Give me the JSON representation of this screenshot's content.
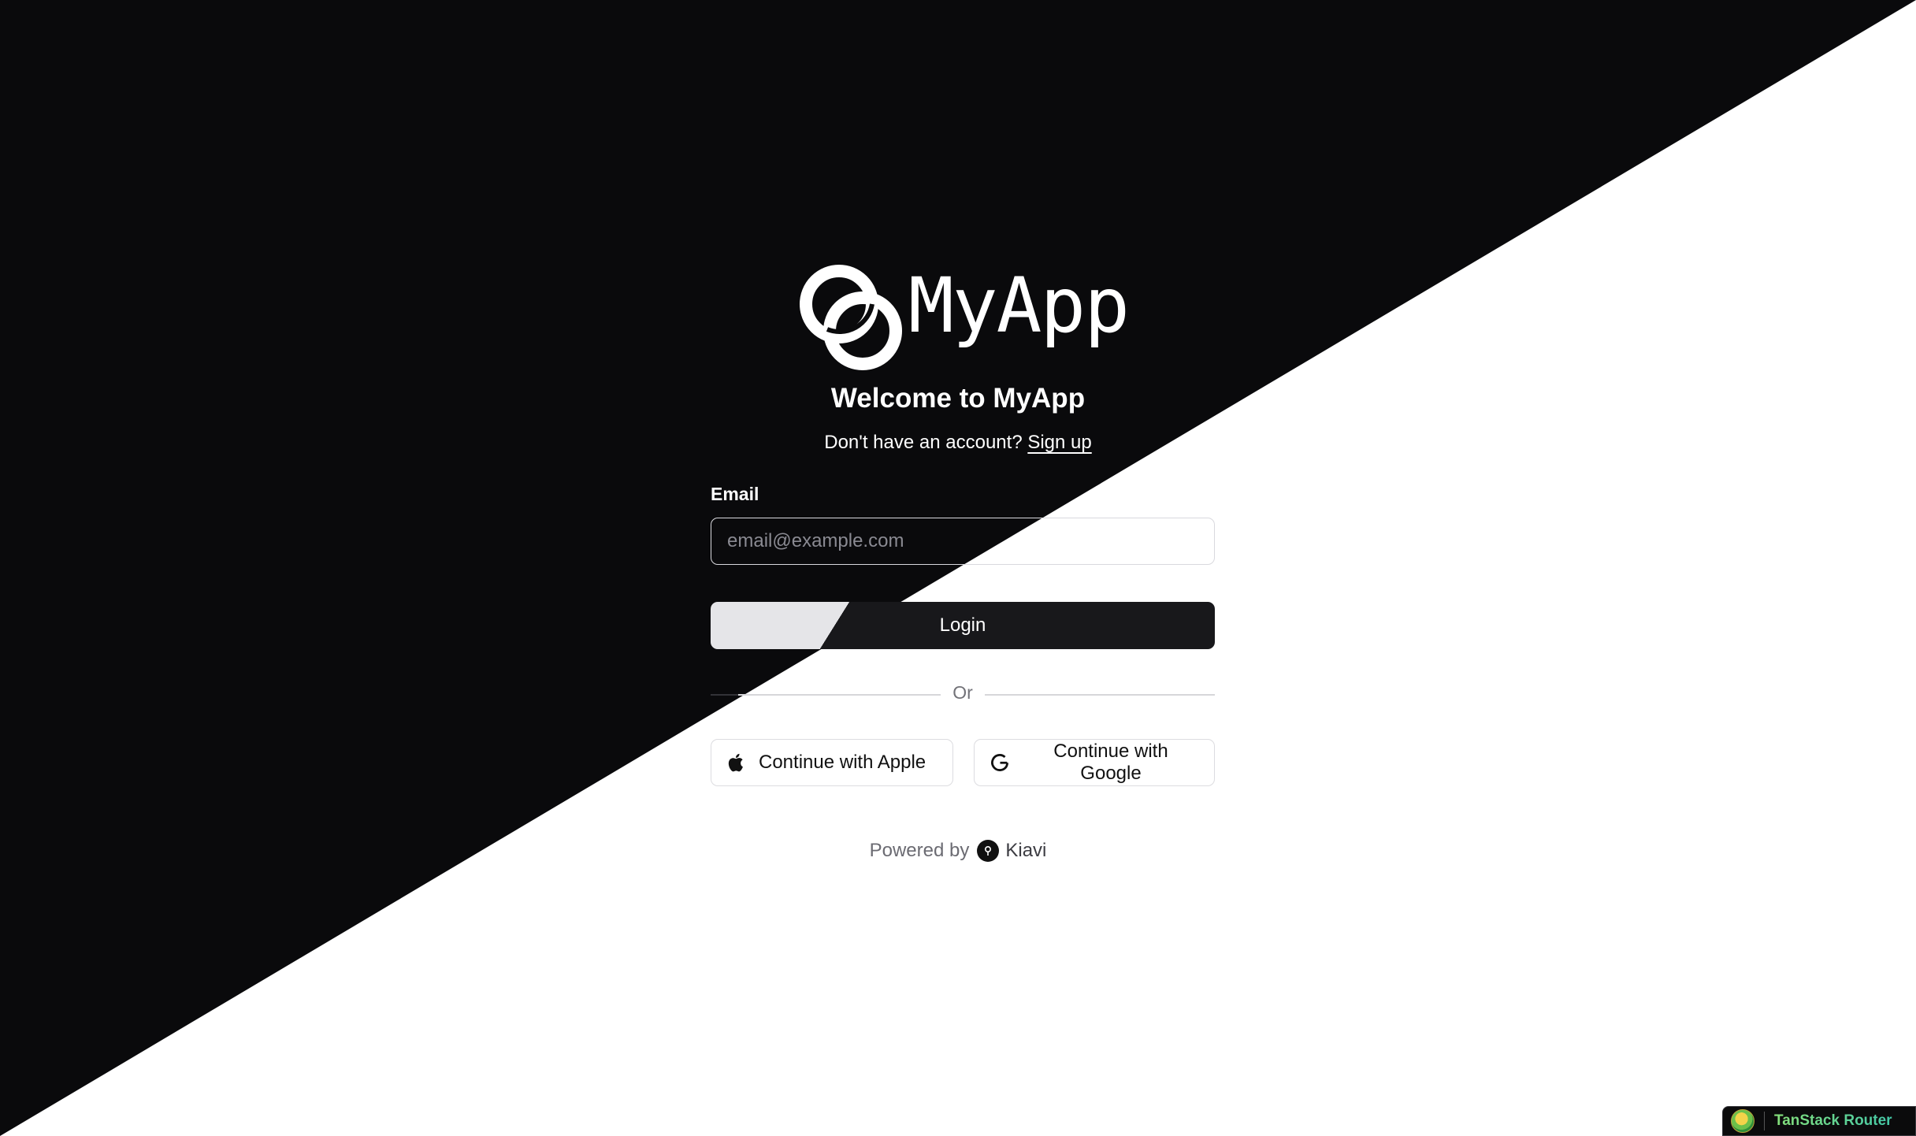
{
  "app": {
    "name": "MyApp",
    "logo_icon": "linked-rings-icon"
  },
  "heading": {
    "title": "Welcome to MyApp",
    "signup_prompt": "Don't have an account?",
    "signup_link": "Sign up"
  },
  "form": {
    "email_label": "Email",
    "email_placeholder": "email@example.com",
    "email_value": "",
    "login_label": "Login",
    "divider_text": "Or"
  },
  "oauth": {
    "apple": {
      "label": "Continue with Apple",
      "icon": "apple-icon"
    },
    "google": {
      "label": "Continue with Google",
      "icon": "google-icon"
    }
  },
  "footer": {
    "powered_by": "Powered by",
    "brand": "Kiavi",
    "brand_icon": "kiavi-pin-icon"
  },
  "devtools": {
    "label": "TanStack Router",
    "icon": "tanstack-logo-icon"
  },
  "colors": {
    "dark_bg": "#0a0a0c",
    "light_bg": "#ffffff",
    "button_dark": "#18181b",
    "devtools_text": "#6fd88a"
  }
}
